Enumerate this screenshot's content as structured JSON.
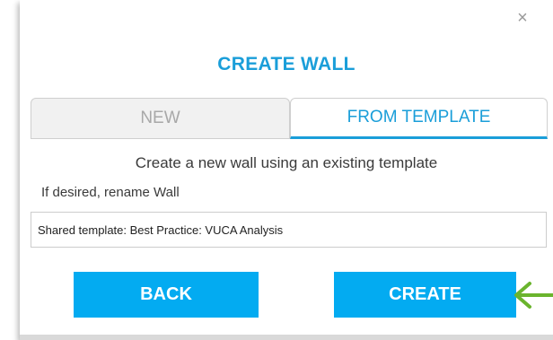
{
  "dialog": {
    "close_symbol": "×",
    "title": "CREATE WALL",
    "tabs": [
      {
        "label": "NEW",
        "active": false
      },
      {
        "label": "FROM TEMPLATE",
        "active": true
      }
    ],
    "subtitle": "Create a new wall using an existing template",
    "rename_label": "If desired, rename Wall",
    "name_input_value": "Shared template: Best Practice: VUCA Analysis",
    "back_label": "BACK",
    "create_label": "CREATE"
  },
  "colors": {
    "accent": "#1a9ed9",
    "button": "#03abf1",
    "annotation_arrow": "#6ab42d"
  },
  "icons": {
    "close": "close-icon",
    "annotation": "arrow-left-icon"
  }
}
